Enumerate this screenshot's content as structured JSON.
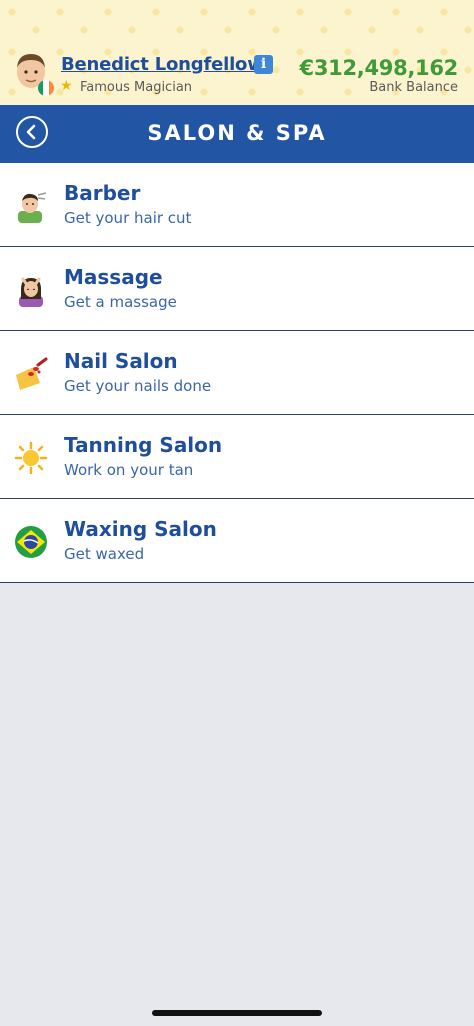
{
  "header": {
    "player_name": "Benedict Longfellow",
    "player_title": "Famous Magician",
    "bank_amount": "€312,498,162",
    "bank_label": "Bank Balance",
    "info_icon_text": "i",
    "accent_color": "#2255a4",
    "money_color": "#3f9a3a"
  },
  "nav": {
    "title": "SALON & SPA"
  },
  "menu": {
    "items": [
      {
        "title": "Barber",
        "subtitle": "Get your hair cut",
        "icon": "barber-icon"
      },
      {
        "title": "Massage",
        "subtitle": "Get a massage",
        "icon": "massage-icon"
      },
      {
        "title": "Nail Salon",
        "subtitle": "Get your nails done",
        "icon": "nail-polish-icon"
      },
      {
        "title": "Tanning Salon",
        "subtitle": "Work on your tan",
        "icon": "sun-icon"
      },
      {
        "title": "Waxing Salon",
        "subtitle": "Get waxed",
        "icon": "brazil-flag-icon"
      }
    ]
  }
}
